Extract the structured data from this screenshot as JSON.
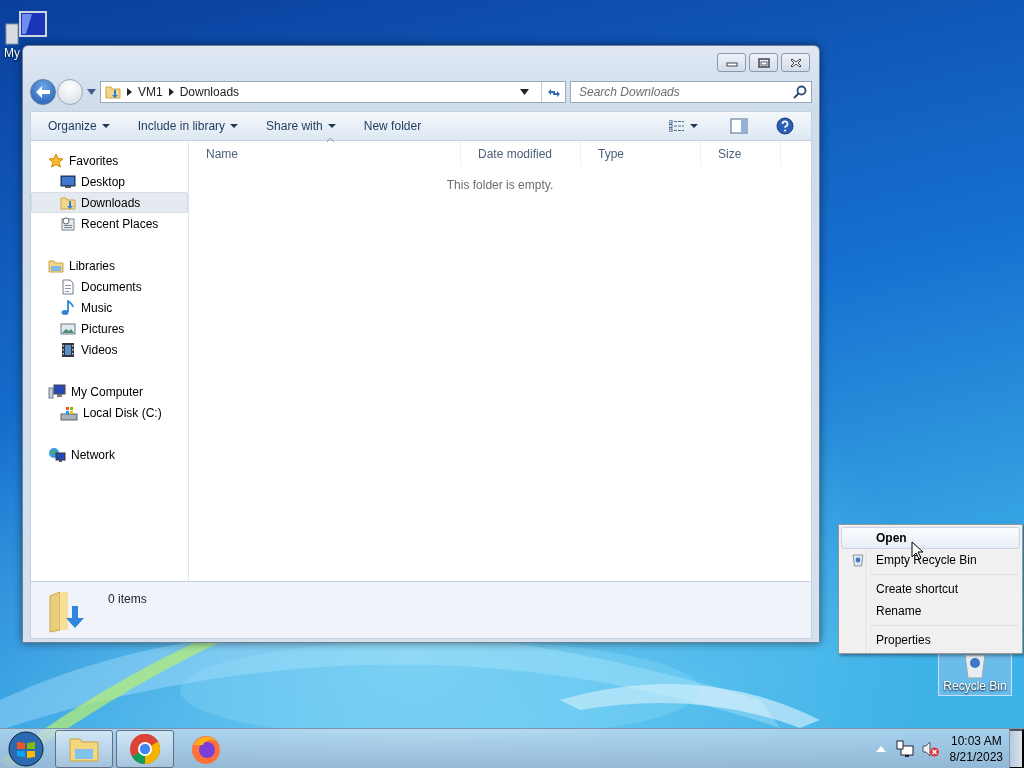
{
  "desktop_icons": [
    {
      "kind": "computer",
      "label": "My",
      "selected": false
    },
    {
      "kind": "recycle",
      "label": "Recycle Bin",
      "selected": true
    }
  ],
  "window": {
    "address": {
      "path": [
        "VM1",
        "Downloads"
      ]
    },
    "search": {
      "placeholder": "Search Downloads"
    },
    "toolbar": [
      {
        "label": "Organize",
        "dropdown": true
      },
      {
        "label": "Include in library",
        "dropdown": true
      },
      {
        "label": "Share with",
        "dropdown": true
      },
      {
        "label": "New folder",
        "dropdown": false
      }
    ],
    "sidebar": {
      "groups": [
        {
          "kind": "star",
          "label": "Favorites",
          "children": [
            {
              "kind": "desktop",
              "label": "Desktop",
              "selected": false
            },
            {
              "kind": "downloads",
              "label": "Downloads",
              "selected": true
            },
            {
              "kind": "recent",
              "label": "Recent Places",
              "selected": false
            }
          ]
        },
        {
          "kind": "libraries",
          "label": "Libraries",
          "children": [
            {
              "kind": "documents",
              "label": "Documents",
              "selected": false
            },
            {
              "kind": "music",
              "label": "Music",
              "selected": false
            },
            {
              "kind": "pictures",
              "label": "Pictures",
              "selected": false
            },
            {
              "kind": "videos",
              "label": "Videos",
              "selected": false
            }
          ]
        },
        {
          "kind": "computer",
          "label": "My Computer",
          "children": [
            {
              "kind": "disk",
              "label": "Local Disk (C:)",
              "selected": false
            }
          ]
        },
        {
          "kind": "network",
          "label": "Network"
        }
      ]
    },
    "columns": [
      "Name",
      "Date modified",
      "Type",
      "Size"
    ],
    "empty_message": "This folder is empty.",
    "status": "0 items"
  },
  "context_menu": {
    "items": [
      {
        "kind": "item",
        "label": "Open",
        "bold": true,
        "hovered": true,
        "has_icon": false
      },
      {
        "kind": "item",
        "label": "Empty Recycle Bin",
        "bold": false,
        "hovered": false,
        "has_icon": true
      },
      {
        "kind": "separator"
      },
      {
        "kind": "item",
        "label": "Create shortcut",
        "bold": false,
        "hovered": false,
        "has_icon": false
      },
      {
        "kind": "item",
        "label": "Rename",
        "bold": false,
        "hovered": false,
        "has_icon": false
      },
      {
        "kind": "separator"
      },
      {
        "kind": "item",
        "label": "Properties",
        "bold": false,
        "hovered": false,
        "has_icon": false
      }
    ]
  },
  "taskbar": {
    "apps": [
      {
        "kind": "explorer",
        "running": true
      },
      {
        "kind": "chrome",
        "running": true
      },
      {
        "kind": "firefox",
        "running": false
      }
    ],
    "clock": {
      "time": "10:03 AM",
      "date": "8/21/2023"
    }
  }
}
